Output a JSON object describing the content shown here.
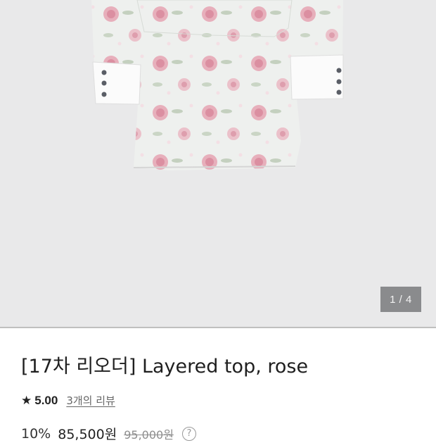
{
  "gallery": {
    "counter": "1 / 4",
    "image_alt": "Floral layered top with white cuffs"
  },
  "product": {
    "title": "[17차 리오더] Layered top, rose",
    "rating": {
      "star_icon": "★",
      "score": "5.00",
      "reviews": "3개의 리뷰"
    },
    "price": {
      "discount": "10%",
      "sale": "85,500원",
      "original": "95,000원",
      "help_icon": "?"
    }
  },
  "colors": {
    "gallery_bg": "#e9e9ea",
    "counter_bg": "#8a8b8d",
    "rose_pink": "#e7a3b3"
  }
}
